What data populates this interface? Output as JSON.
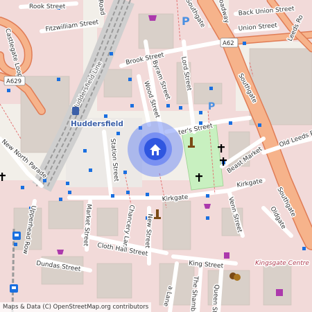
{
  "map": {
    "colors": {
      "background": "#f2efe9",
      "urban": "#f2dad9",
      "building": "#d9d0c9",
      "major_road": "#f6b38b",
      "major_road_casing": "#e07c55",
      "minor_road": "#ffffff",
      "park": "#c8f0c0",
      "bus_stop": "#1a6fe0",
      "location_accent": "#4c6ef5",
      "parking": "#4a90e2",
      "shop": "#ac39ac",
      "rail": "#9a9a9a"
    },
    "roads": [
      {
        "id": "rook-street",
        "label": "Rook Street"
      },
      {
        "id": "fitzwilliam-street",
        "label": "Fitzwilliam Street"
      },
      {
        "id": "castlegate-loop",
        "label": "Castlegate Loop"
      },
      {
        "id": "brook-street",
        "label": "Brook Street"
      },
      {
        "id": "byram-street",
        "label": "Byram Street"
      },
      {
        "id": "lord-street",
        "label": "Lord Street"
      },
      {
        "id": "wood-street",
        "label": "Wood Street"
      },
      {
        "id": "back-union-street",
        "label": "Back Union Street"
      },
      {
        "id": "union-street",
        "label": "Union Street"
      },
      {
        "id": "leeds-road",
        "label": "Leeds Ro"
      },
      {
        "id": "southgate-top",
        "label": "Southgate"
      },
      {
        "id": "southgate-mid",
        "label": "Southgate"
      },
      {
        "id": "southgate-low",
        "label": "Southgate"
      },
      {
        "id": "old-leeds-road",
        "label": "Old Leeds Ro"
      },
      {
        "id": "new-north-parade",
        "label": "New North Parade"
      },
      {
        "id": "station-street",
        "label": "Station Street"
      },
      {
        "id": "st-peters-street",
        "label": "ter's Street"
      },
      {
        "id": "beast-market",
        "label": "Beast Market"
      },
      {
        "id": "kirkgate-east",
        "label": "Kirkgate"
      },
      {
        "id": "kirkgate-west",
        "label": "Kirkgate"
      },
      {
        "id": "venn-street",
        "label": "Venn Street"
      },
      {
        "id": "oldgate",
        "label": "Oldgate"
      },
      {
        "id": "upperhead-row",
        "label": "Upperhead Row"
      },
      {
        "id": "market-street",
        "label": "Market Street"
      },
      {
        "id": "chancery-lane",
        "label": "Chancery Lane"
      },
      {
        "id": "new-street",
        "label": "New Street"
      },
      {
        "id": "cloth-hall-street",
        "label": "Cloth Hall Street"
      },
      {
        "id": "dundas-street",
        "label": "Dundas Street"
      },
      {
        "id": "king-street",
        "label": "King Street"
      },
      {
        "id": "the-shambles",
        "label": "The Shambles"
      },
      {
        "id": "queen-street",
        "label": "Queen St"
      },
      {
        "id": "ramsden-lane",
        "label": "a Lane"
      },
      {
        "id": "station-road",
        "label": "Road"
      },
      {
        "id": "railway-label",
        "label": "Huddersfield Line"
      },
      {
        "id": "oadway",
        "label": "oadway"
      }
    ],
    "shields": [
      {
        "id": "a629",
        "label": "A629"
      },
      {
        "id": "a62",
        "label": "A62"
      }
    ],
    "places": {
      "station": "Huddersfield",
      "centre": "Kingsgate Centre"
    },
    "attribution": "Maps & Data (C) OpenStreetMap.org contributors",
    "icons": [
      "parking-icon",
      "shop-icon",
      "church-icon",
      "monument-icon",
      "home-location-icon",
      "bus-stop-icon",
      "train-icon",
      "theatre-icon"
    ]
  }
}
